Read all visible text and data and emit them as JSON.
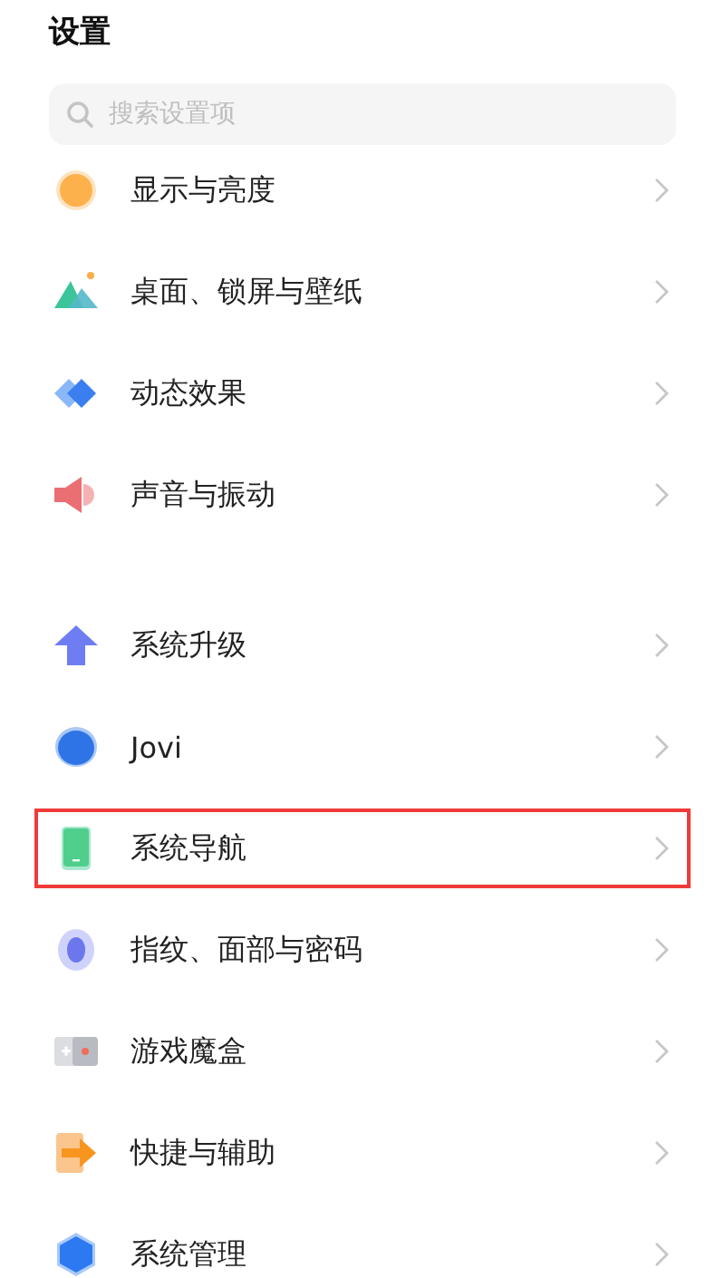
{
  "title": "设置",
  "search": {
    "placeholder": "搜索设置项"
  },
  "groups": [
    {
      "items": [
        {
          "label": "显示与亮度",
          "kind": "sun",
          "highlighted": false
        },
        {
          "label": "桌面、锁屏与壁纸",
          "kind": "mountain",
          "highlighted": false
        },
        {
          "label": "动态效果",
          "kind": "diamonds",
          "highlighted": false
        },
        {
          "label": "声音与振动",
          "kind": "speaker",
          "highlighted": false
        }
      ]
    },
    {
      "items": [
        {
          "label": "系统升级",
          "kind": "arrow-up",
          "highlighted": false
        },
        {
          "label": "Jovi",
          "kind": "blob",
          "highlighted": false
        },
        {
          "label": "系统导航",
          "kind": "phone",
          "highlighted": true
        },
        {
          "label": "指纹、面部与密码",
          "kind": "fingerprint",
          "highlighted": false
        },
        {
          "label": "游戏魔盒",
          "kind": "game",
          "highlighted": false
        },
        {
          "label": "快捷与辅助",
          "kind": "arrow-right",
          "highlighted": false
        },
        {
          "label": "系统管理",
          "kind": "hexagon",
          "highlighted": false
        }
      ]
    }
  ]
}
